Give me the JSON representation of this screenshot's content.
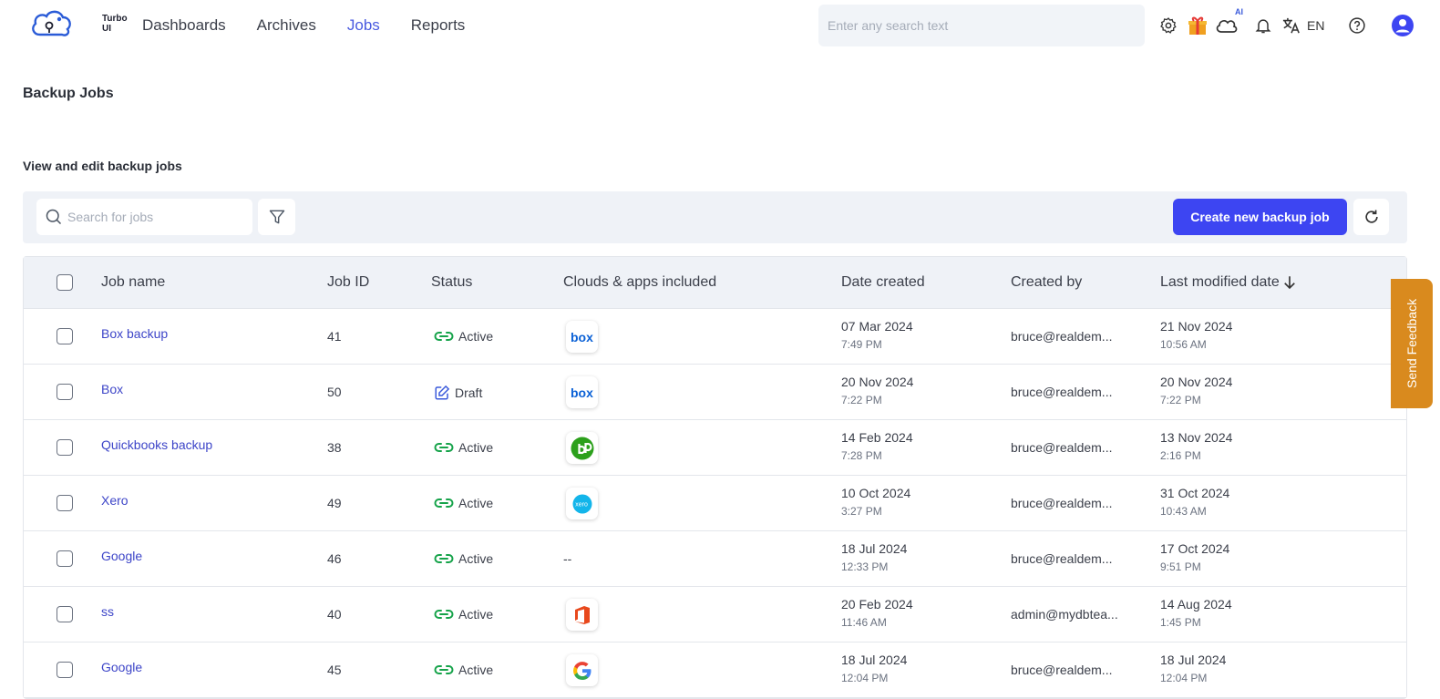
{
  "app": {
    "logo_text": "Turbo UI",
    "nav": [
      {
        "label": "Dashboards",
        "active": false
      },
      {
        "label": "Archives",
        "active": false
      },
      {
        "label": "Jobs",
        "active": true
      },
      {
        "label": "Reports",
        "active": false
      }
    ],
    "search_placeholder": "Enter any search text",
    "ai_badge": "AI",
    "language": "EN",
    "icons": [
      "gear-icon",
      "gift-icon",
      "cloud-ai-icon",
      "bell-icon",
      "translate-icon",
      "help-icon",
      "user-avatar-icon"
    ]
  },
  "page": {
    "title": "Backup Jobs",
    "subtitle": "View and edit backup jobs"
  },
  "toolbar": {
    "search_placeholder": "Search for jobs",
    "create_label": "Create new backup job",
    "accent": "#3d45f2"
  },
  "table": {
    "headers": {
      "name": "Job name",
      "id": "Job ID",
      "status": "Status",
      "apps": "Clouds & apps included",
      "created": "Date created",
      "by": "Created by",
      "modified": "Last modified date"
    },
    "rows": [
      {
        "name": "Box backup",
        "id": "41",
        "status": "Active",
        "status_icon": "link-icon",
        "app": "box",
        "created_date": "07 Mar 2024",
        "created_time": "7:49 PM",
        "by": "bruce@realdem...",
        "mod_date": "21 Nov 2024",
        "mod_time": "10:56 AM"
      },
      {
        "name": "Box",
        "id": "50",
        "status": "Draft",
        "status_icon": "edit-icon",
        "app": "box",
        "created_date": "20 Nov 2024",
        "created_time": "7:22 PM",
        "by": "bruce@realdem...",
        "mod_date": "20 Nov 2024",
        "mod_time": "7:22 PM"
      },
      {
        "name": "Quickbooks backup",
        "id": "38",
        "status": "Active",
        "status_icon": "link-icon",
        "app": "quickbooks",
        "created_date": "14 Feb 2024",
        "created_time": "7:28 PM",
        "by": "bruce@realdem...",
        "mod_date": "13 Nov 2024",
        "mod_time": "2:16 PM"
      },
      {
        "name": "Xero",
        "id": "49",
        "status": "Active",
        "status_icon": "link-icon",
        "app": "xero",
        "created_date": "10 Oct 2024",
        "created_time": "3:27 PM",
        "by": "bruce@realdem...",
        "mod_date": "31 Oct 2024",
        "mod_time": "10:43 AM"
      },
      {
        "name": "Google",
        "id": "46",
        "status": "Active",
        "status_icon": "link-icon",
        "app": "none",
        "app_text": "--",
        "created_date": "18 Jul 2024",
        "created_time": "12:33 PM",
        "by": "bruce@realdem...",
        "mod_date": "17 Oct 2024",
        "mod_time": "9:51 PM"
      },
      {
        "name": "ss",
        "id": "40",
        "status": "Active",
        "status_icon": "link-icon",
        "app": "office",
        "created_date": "20 Feb 2024",
        "created_time": "11:46 AM",
        "by": "admin@mydbtea...",
        "mod_date": "14 Aug 2024",
        "mod_time": "1:45 PM"
      },
      {
        "name": "Google",
        "id": "45",
        "status": "Active",
        "status_icon": "link-icon",
        "app": "google",
        "created_date": "18 Jul 2024",
        "created_time": "12:04 PM",
        "by": "bruce@realdem...",
        "mod_date": "18 Jul 2024",
        "mod_time": "12:04 PM"
      }
    ]
  },
  "feedback_label": "Send Feedback"
}
